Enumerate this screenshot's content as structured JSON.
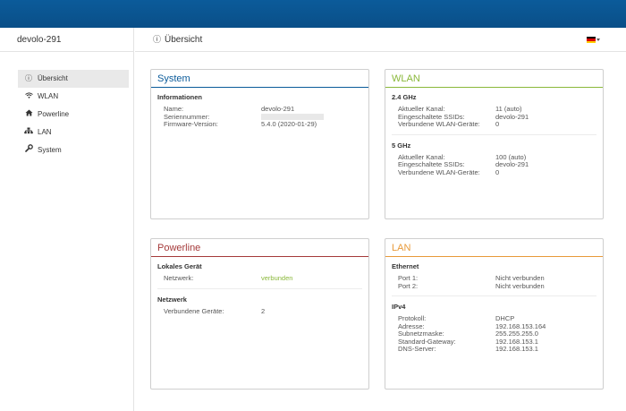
{
  "header": {
    "device_name": "devolo-291",
    "page_title": "Übersicht",
    "colors": {
      "bar": "#0b5b9a"
    },
    "language_flag": {
      "icon": "flag-de-icon",
      "colors": [
        "#000000",
        "#dd0000",
        "#ffce00"
      ]
    }
  },
  "sidebar": {
    "items": [
      {
        "label": "Übersicht",
        "icon": "info-icon",
        "active": true
      },
      {
        "label": "WLAN",
        "icon": "wifi-icon",
        "active": false
      },
      {
        "label": "Powerline",
        "icon": "home-icon",
        "active": false
      },
      {
        "label": "LAN",
        "icon": "network-icon",
        "active": false
      },
      {
        "label": "System",
        "icon": "wrench-icon",
        "active": false
      }
    ]
  },
  "system": {
    "title": "System",
    "section": "Informationen",
    "rows": [
      {
        "key": "Name:",
        "value": "devolo-291"
      },
      {
        "key": "Seriennummer:",
        "value": ""
      },
      {
        "key": "Firmware-Version:",
        "value": "5.4.0 (2020-01-29)"
      }
    ]
  },
  "wlan": {
    "title": "WLAN",
    "band24": {
      "title": "2.4 GHz",
      "rows": [
        {
          "key": "Aktueller Kanal:",
          "value": "11 (auto)"
        },
        {
          "key": "Eingeschaltete SSIDs:",
          "value": "devolo-291"
        },
        {
          "key": "Verbundene WLAN-Geräte:",
          "value": "0"
        }
      ]
    },
    "band5": {
      "title": "5 GHz",
      "rows": [
        {
          "key": "Aktueller Kanal:",
          "value": "100 (auto)"
        },
        {
          "key": "Eingeschaltete SSIDs:",
          "value": "devolo-291"
        },
        {
          "key": "Verbundene WLAN-Geräte:",
          "value": "0"
        }
      ]
    }
  },
  "powerline": {
    "title": "Powerline",
    "local": {
      "title": "Lokales Gerät",
      "rows": [
        {
          "key": "Netzwerk:",
          "value": "verbunden"
        }
      ]
    },
    "network": {
      "title": "Netzwerk",
      "rows": [
        {
          "key": "Verbundene Geräte:",
          "value": "2"
        }
      ]
    }
  },
  "lan": {
    "title": "LAN",
    "ethernet": {
      "title": "Ethernet",
      "rows": [
        {
          "key": "Port 1:",
          "value": "Nicht verbunden"
        },
        {
          "key": "Port 2:",
          "value": "Nicht verbunden"
        }
      ]
    },
    "ipv4": {
      "title": "IPv4",
      "rows": [
        {
          "key": "Protokoll:",
          "value": "DHCP"
        },
        {
          "key": "Adresse:",
          "value": "192.168.153.164"
        },
        {
          "key": "Subnetzmaske:",
          "value": "255.255.255.0"
        },
        {
          "key": "Standard-Gateway:",
          "value": "192.168.153.1"
        },
        {
          "key": "DNS-Server:",
          "value": "192.168.153.1"
        }
      ]
    }
  }
}
